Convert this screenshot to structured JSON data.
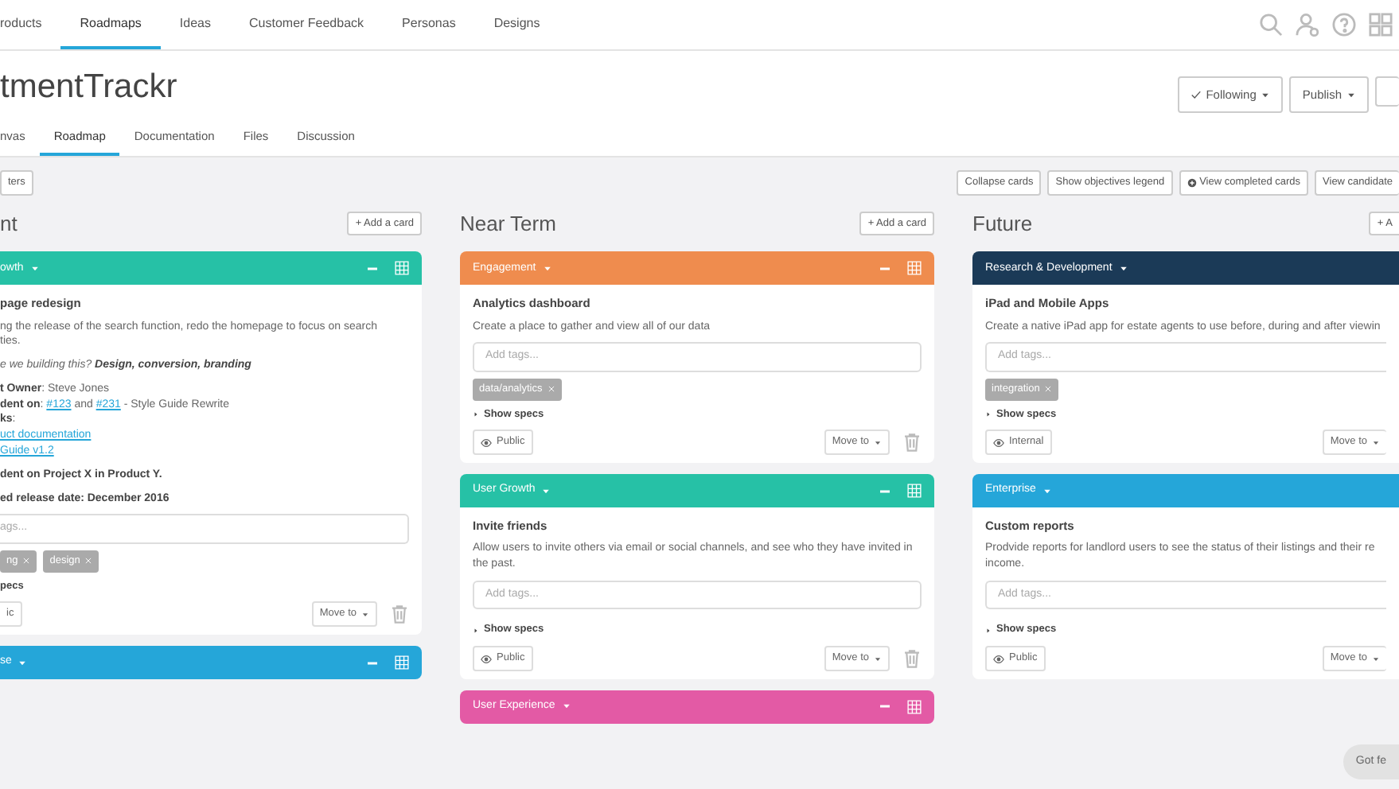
{
  "top_nav": {
    "items": [
      {
        "label": "roducts",
        "selected": false
      },
      {
        "label": "Roadmaps",
        "selected": true
      },
      {
        "label": "Ideas",
        "selected": false
      },
      {
        "label": "Customer Feedback",
        "selected": false
      },
      {
        "label": "Personas",
        "selected": false
      },
      {
        "label": "Designs",
        "selected": false
      }
    ]
  },
  "project": {
    "title": "tmentTrackr",
    "following_button": "Following",
    "publish_button": "Publish"
  },
  "sub_tabs": [
    {
      "label": "nvas",
      "selected": false
    },
    {
      "label": "Roadmap",
      "selected": true
    },
    {
      "label": "Documentation",
      "selected": false
    },
    {
      "label": "Files",
      "selected": false
    },
    {
      "label": "Discussion",
      "selected": false
    }
  ],
  "toolbar": {
    "filters_button": "ters",
    "buttons": [
      {
        "label": "Collapse cards",
        "kind": "plain"
      },
      {
        "label": "Show objectives legend",
        "kind": "plain"
      },
      {
        "label": "View completed cards",
        "kind": "add"
      },
      {
        "label": "View candidate",
        "kind": "plain"
      }
    ]
  },
  "columns": [
    {
      "title": "nt",
      "add_card": "+ Add a card",
      "cards": [
        {
          "category": "owth",
          "color": "#26c1a6",
          "title": "page redesign",
          "paragraphs": [
            [
              [
                {
                  "text": "ng the release of the search function, redo the homepage to focus on search",
                  "kind": "plain"
                }
              ],
              [
                {
                  "text": "ties.",
                  "kind": "plain"
                }
              ]
            ],
            [
              [
                {
                  "text": "e we building this? ",
                  "kind": "italic"
                },
                {
                  "text": "Design, conversion, branding",
                  "kind": "bolditalic"
                }
              ]
            ],
            [
              [
                {
                  "text": "t Owner",
                  "kind": "bold"
                },
                {
                  "text": ": Steve Jones",
                  "kind": "plain"
                }
              ],
              [
                {
                  "text": "dent on",
                  "kind": "bold"
                },
                {
                  "text": ": ",
                  "kind": "plain"
                },
                {
                  "text": "#123",
                  "kind": "link"
                },
                {
                  "text": " and ",
                  "kind": "plain"
                },
                {
                  "text": "#231",
                  "kind": "link"
                },
                {
                  "text": " - Style Guide Rewrite",
                  "kind": "plain"
                }
              ],
              [
                {
                  "text": "ks",
                  "kind": "bold"
                },
                {
                  "text": ":",
                  "kind": "plain"
                }
              ],
              [
                {
                  "text": "uct documentation",
                  "kind": "link"
                }
              ],
              [
                {
                  "text": "Guide v1.2",
                  "kind": "link"
                }
              ]
            ],
            [
              [
                {
                  "text": "dent on Project X in Product Y.",
                  "kind": "bold"
                }
              ]
            ],
            [
              [
                {
                  "text": "ed release date: December 2016",
                  "kind": "bold"
                }
              ]
            ]
          ],
          "tags_placeholder": "ags...",
          "tags": [
            "ng",
            "design"
          ],
          "show_specs": "pecs",
          "visibility": "ic",
          "move_to": "Move to"
        },
        {
          "category": "se",
          "color": "#25a6d9"
        }
      ]
    },
    {
      "title": "Near Term",
      "add_card": "+ Add a card",
      "cards": [
        {
          "category": "Engagement",
          "color": "#ef8c4e",
          "title": "Analytics dashboard",
          "paragraphs": [
            [
              [
                {
                  "text": "Create a place to gather and view all of our data",
                  "kind": "plain"
                }
              ]
            ]
          ],
          "tags_placeholder": "Add tags...",
          "tags": [
            "data/analytics"
          ],
          "show_specs": "Show specs",
          "visibility": "Public",
          "move_to": "Move to"
        },
        {
          "category": "User Growth",
          "color": "#26c1a6",
          "title": "Invite friends",
          "paragraphs": [
            [
              [
                {
                  "text": "Allow users to invite others via email or social channels, and see who they have invited in the past.",
                  "kind": "plain"
                }
              ]
            ]
          ],
          "tags_placeholder": "Add tags...",
          "show_specs": "Show specs",
          "visibility": "Public",
          "move_to": "Move to"
        },
        {
          "category": "User Experience",
          "color": "#e35aa5"
        }
      ]
    },
    {
      "title": "Future",
      "add_card": "+ A",
      "cards": [
        {
          "category": "Research & Development",
          "color": "#1b3a57",
          "title": "iPad and Mobile Apps",
          "paragraphs": [
            [
              [
                {
                  "text": "Create a native iPad app for estate agents to use before, during and after viewin",
                  "kind": "plain"
                }
              ]
            ]
          ],
          "tags_placeholder": "Add tags...",
          "tags": [
            "integration"
          ],
          "show_specs": "Show specs",
          "visibility": "Internal",
          "move_to": "Move to"
        },
        {
          "category": "Enterprise",
          "color": "#25a6d9",
          "title": "Custom reports",
          "paragraphs": [
            [
              [
                {
                  "text": "Prodvide reports for landlord users to see the status of their listings and their re",
                  "kind": "plain"
                }
              ],
              [
                {
                  "text": "income.",
                  "kind": "plain"
                }
              ]
            ]
          ],
          "tags_placeholder": "Add tags...",
          "show_specs": "Show specs",
          "visibility": "Public",
          "move_to": "Move to"
        }
      ]
    }
  ],
  "feedback_button": "Got fe"
}
